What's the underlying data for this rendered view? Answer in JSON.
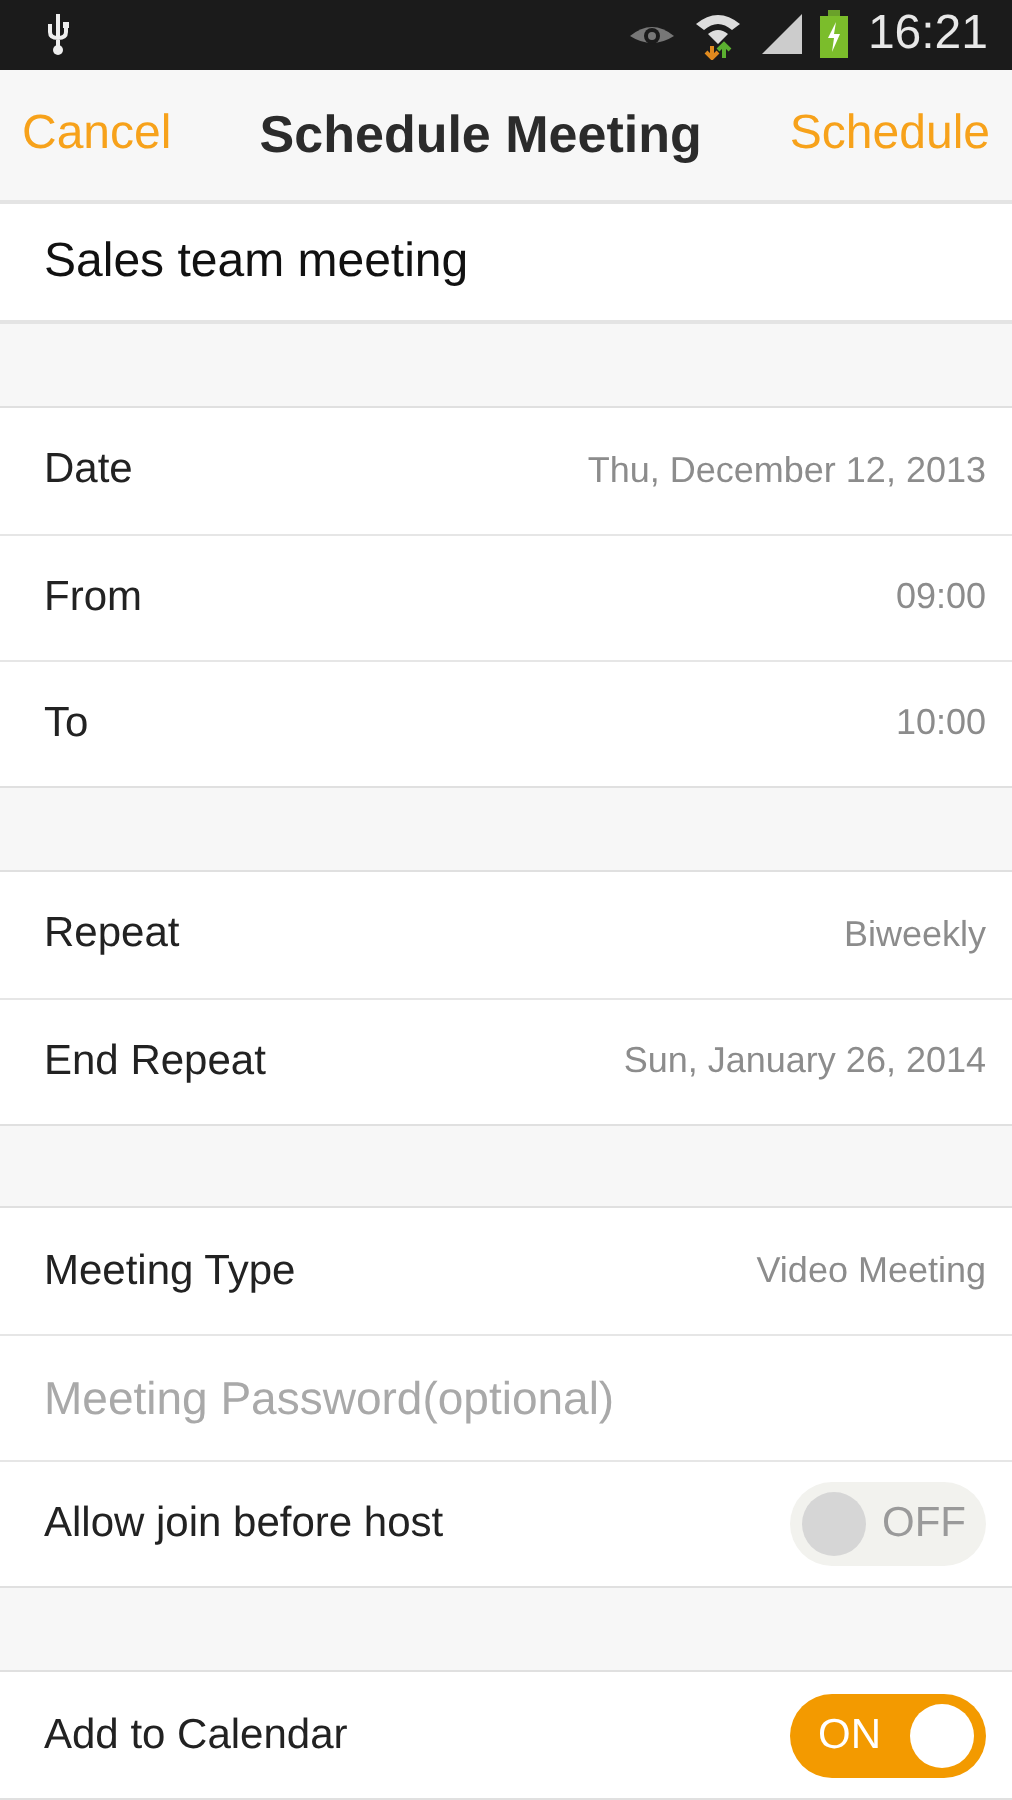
{
  "status_bar": {
    "time": "16:21"
  },
  "header": {
    "cancel": "Cancel",
    "title": "Schedule Meeting",
    "action": "Schedule"
  },
  "topic": {
    "value": "Sales team meeting"
  },
  "groups": [
    {
      "rows": [
        {
          "kind": "value",
          "label": "Date",
          "value": "Thu, December 12, 2013"
        },
        {
          "kind": "value",
          "label": "From",
          "value": "09:00"
        },
        {
          "kind": "value",
          "label": "To",
          "value": "10:00"
        }
      ]
    },
    {
      "rows": [
        {
          "kind": "value",
          "label": "Repeat",
          "value": "Biweekly"
        },
        {
          "kind": "value",
          "label": "End Repeat",
          "value": "Sun, January 26, 2014"
        }
      ]
    },
    {
      "rows": [
        {
          "kind": "value",
          "label": "Meeting Type",
          "value": "Video Meeting"
        },
        {
          "kind": "field",
          "placeholder": "Meeting Password(optional)"
        },
        {
          "kind": "toggle",
          "label": "Allow join before host",
          "on": false,
          "state_text": "OFF"
        }
      ]
    },
    {
      "rows": [
        {
          "kind": "toggle",
          "label": "Add to Calendar",
          "on": true,
          "state_text": "ON"
        }
      ]
    }
  ]
}
